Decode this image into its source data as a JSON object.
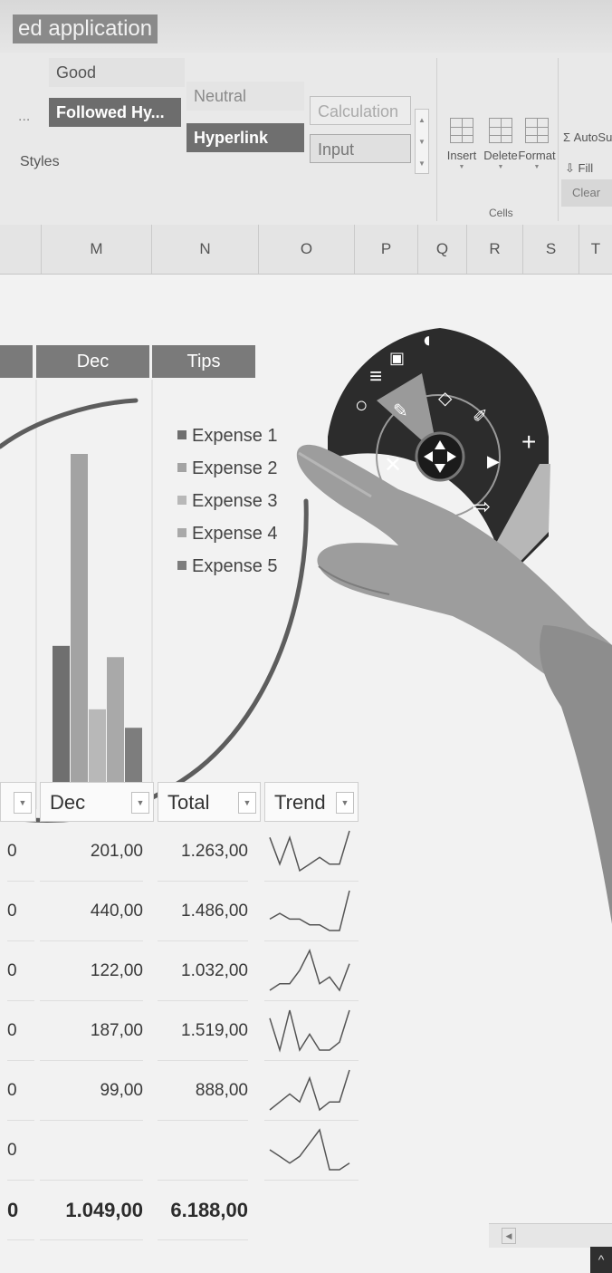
{
  "document": {
    "title": "ed application"
  },
  "ribbon": {
    "styles": {
      "good": "Good",
      "neutral": "Neutral",
      "calculation": "Calculation",
      "followed_hyperlink": "Followed Hy...",
      "hyperlink": "Hyperlink",
      "input": "Input",
      "more": "...",
      "group_label": "Styles"
    },
    "cells": {
      "insert": "Insert",
      "delete": "Delete",
      "format": "Format",
      "group_label": "Cells"
    },
    "editing": {
      "autosum": "AutoSum",
      "fill": "Fill",
      "clear": "Clear"
    }
  },
  "columns": [
    "M",
    "N",
    "O",
    "P",
    "Q",
    "R",
    "S",
    "T"
  ],
  "chart": {
    "headers": {
      "dec": "Dec",
      "tips": "Tips"
    },
    "legend": [
      "Expense 1",
      "Expense 2",
      "Expense 3",
      "Expense 4",
      "Expense 5"
    ]
  },
  "chart_data": {
    "type": "bar",
    "categories": [
      "Expense 1",
      "Expense 2",
      "Expense 3",
      "Expense 4",
      "Expense 5"
    ],
    "values": [
      201,
      440,
      122,
      187,
      99
    ],
    "legend_placement": "right",
    "grid": false
  },
  "table": {
    "headers": {
      "dec": "Dec",
      "total": "Total",
      "trend": "Trend"
    },
    "rows": [
      {
        "prev": "0",
        "dec": "201,00",
        "total": "1.263,00",
        "trend": [
          6,
          2,
          6,
          1,
          2,
          3,
          2,
          2,
          7
        ]
      },
      {
        "prev": "0",
        "dec": "440,00",
        "total": "1.486,00",
        "trend": [
          3,
          4,
          3,
          3,
          2,
          2,
          1,
          1,
          8
        ]
      },
      {
        "prev": "0",
        "dec": "122,00",
        "total": "1.032,00",
        "trend": [
          2,
          3,
          3,
          5,
          8,
          3,
          4,
          2,
          6
        ]
      },
      {
        "prev": "0",
        "dec": "187,00",
        "total": "1.519,00",
        "trend": [
          6,
          2,
          7,
          2,
          4,
          2,
          2,
          3,
          7
        ]
      },
      {
        "prev": "0",
        "dec": "99,00",
        "total": "888,00",
        "trend": [
          3,
          4,
          5,
          4,
          7,
          3,
          4,
          4,
          8
        ]
      },
      {
        "prev": "0",
        "dec": "",
        "total": "",
        "trend": [
          5,
          4,
          3,
          4,
          6,
          8,
          2,
          2,
          3
        ]
      }
    ],
    "totals": {
      "prev": "0",
      "dec": "1.049,00",
      "total": "6.188,00"
    }
  },
  "radial_menu": {
    "icons": [
      "mouse-icon",
      "select-icon",
      "list-icon",
      "circle-icon",
      "pen-icon",
      "eraser-icon",
      "highlighter-icon",
      "plus-icon",
      "scissors-icon",
      "play-icon",
      "undo-icon",
      "redo-icon",
      "move-icon"
    ],
    "glyphs": {
      "plus": "+",
      "scissors": "✕",
      "play": "▶",
      "undo": "⇦",
      "redo": "⇨",
      "circle": "○",
      "list": "≡",
      "move": "✥"
    }
  },
  "colors": {
    "header_tab": "#7a7a7a",
    "menu_dark": "#2c2c2c",
    "menu_highlight": "#9a9a9a",
    "annotation_stroke": "#5d5d5d",
    "series": [
      "#6f6f6f",
      "#a3a3a3",
      "#b8b8b8",
      "#a9a9a9",
      "#7d7d7d"
    ]
  }
}
